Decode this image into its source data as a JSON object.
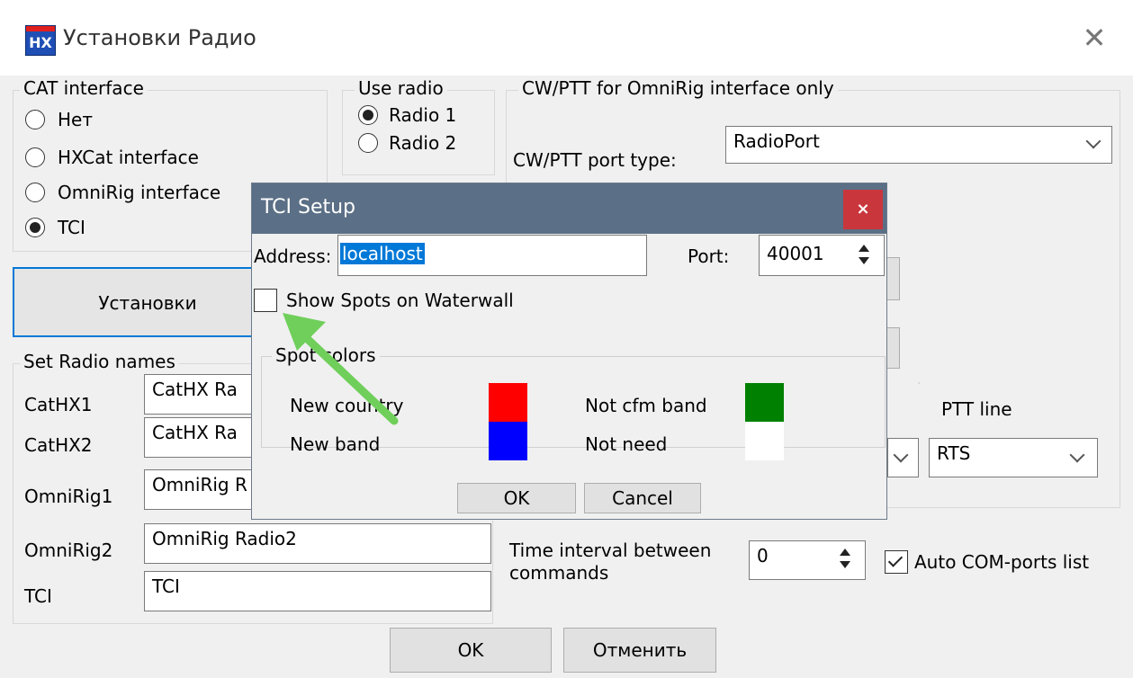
{
  "window": {
    "title": "Установки Радио",
    "close_glyph": "✕",
    "app_icon_text": "HX"
  },
  "cat_interface": {
    "label": "CAT interface",
    "options": [
      "Нет",
      "HXCat interface",
      "OmniRig interface",
      "TCI"
    ],
    "selected": "TCI"
  },
  "use_radio": {
    "label": "Use radio",
    "options": [
      "Radio 1",
      "Radio 2"
    ],
    "selected": "Radio 1"
  },
  "cwptt": {
    "label": "CW/PTT for OmniRig interface only",
    "port_type_label": "CW/PTT port type:",
    "port_type_value": "RadioPort",
    "ptt_line_label": "PTT line",
    "ptt_line_value": "RTS"
  },
  "setup_button": "Установки",
  "radio_names": {
    "label": "Set Radio names",
    "rows": [
      {
        "label": "CatHX1",
        "value": "CatHX Ra"
      },
      {
        "label": "CatHX2",
        "value": "CatHX Ra"
      },
      {
        "label": "OmniRig1",
        "value": "OmniRig R"
      },
      {
        "label": "OmniRig2",
        "value": "OmniRig Radio2"
      },
      {
        "label": "TCI",
        "value": "TCI"
      }
    ]
  },
  "time_interval": {
    "label_line1": "Time interval between",
    "label_line2": "commands",
    "value": "0"
  },
  "auto_com": {
    "label": "Auto COM-ports list",
    "checked": true
  },
  "main_ok": "OK",
  "main_cancel": "Отменить",
  "dialog": {
    "title": "TCI Setup",
    "close_glyph": "×",
    "address_label": "Address:",
    "address_value": "localhost",
    "port_label": "Port:",
    "port_value": "40001",
    "show_spots_label": "Show Spots on Waterwall",
    "show_spots_checked": false,
    "spot_colors_label": "Spot colors",
    "spot_colors": [
      {
        "label": "New country",
        "color": "#ff0000"
      },
      {
        "label": "New band",
        "color": "#0000ff"
      },
      {
        "label": "Not cfm band",
        "color": "#008000"
      },
      {
        "label": "Not need",
        "color": "#ffffff"
      }
    ],
    "ok": "OK",
    "cancel": "Cancel"
  },
  "arrow_color": "#6fcf5a"
}
